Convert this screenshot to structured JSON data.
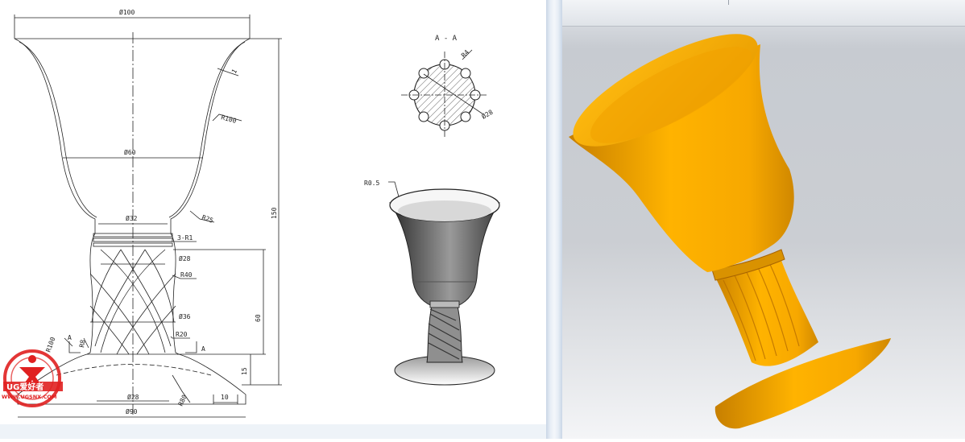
{
  "drawing": {
    "dims": {
      "d100": "Ø100",
      "d60": "Ø60",
      "d32": "Ø32",
      "d28_stem": "Ø28",
      "d36": "Ø36",
      "d28_base": "Ø28",
      "d90": "Ø90",
      "r100": "R100",
      "r25": "R25",
      "r3": "3-R1",
      "r40": "R40",
      "r20": "R20",
      "r8": "R8",
      "r100_base": "R100",
      "r80": "R80",
      "h150": "150",
      "h60": "60",
      "h15": "15",
      "w10": "10",
      "t1": "1"
    },
    "section": {
      "title": "A - A",
      "r4": "R4",
      "d28": "Ø28"
    },
    "render": {
      "r05": "R0.5"
    },
    "cut_marks": [
      "A",
      "A"
    ],
    "watermark": {
      "brand": "UG爱好者",
      "url": "WWW.UGSNX.COM"
    }
  },
  "viewport": {
    "model_color": "#f7a800"
  }
}
